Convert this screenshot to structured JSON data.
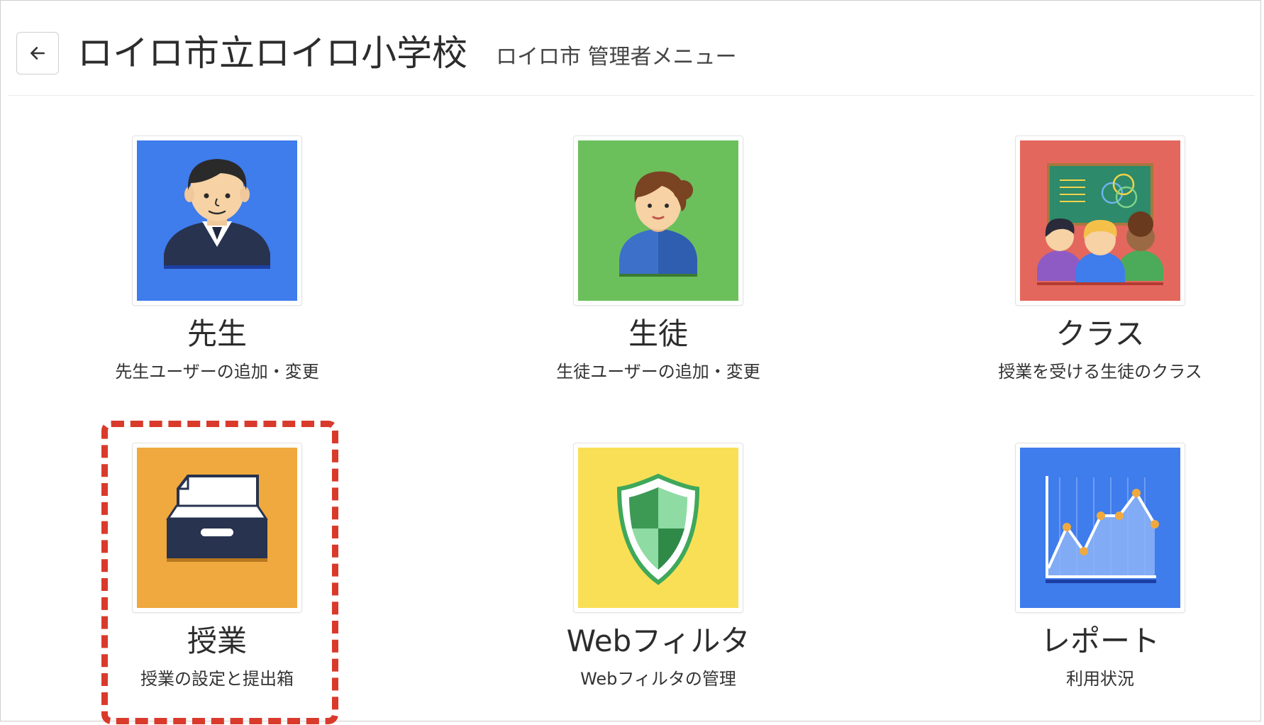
{
  "header": {
    "back_icon": "arrow-left-icon",
    "title": "ロイロ市立ロイロ小学校",
    "subtitle": "ロイロ市 管理者メニュー"
  },
  "tiles": [
    {
      "label": "先生",
      "description": "先生ユーザーの追加・変更",
      "icon": "teacher-icon",
      "color": "#3f7cec"
    },
    {
      "label": "生徒",
      "description": "生徒ユーザーの追加・変更",
      "icon": "student-icon",
      "color": "#6cc05c"
    },
    {
      "label": "クラス",
      "description": "授業を受ける生徒のクラス",
      "icon": "class-icon",
      "color": "#e4675d"
    },
    {
      "label": "授業",
      "description": "授業の設定と提出箱",
      "icon": "file-box-icon",
      "color": "#f0a93e"
    },
    {
      "label": "Webフィルタ",
      "description": "Webフィルタの管理",
      "icon": "shield-icon",
      "color": "#f9df55"
    },
    {
      "label": "レポート",
      "description": "利用状況",
      "icon": "report-chart-icon",
      "color": "#3f7cec"
    }
  ],
  "highlight_color": "#d93a2b"
}
